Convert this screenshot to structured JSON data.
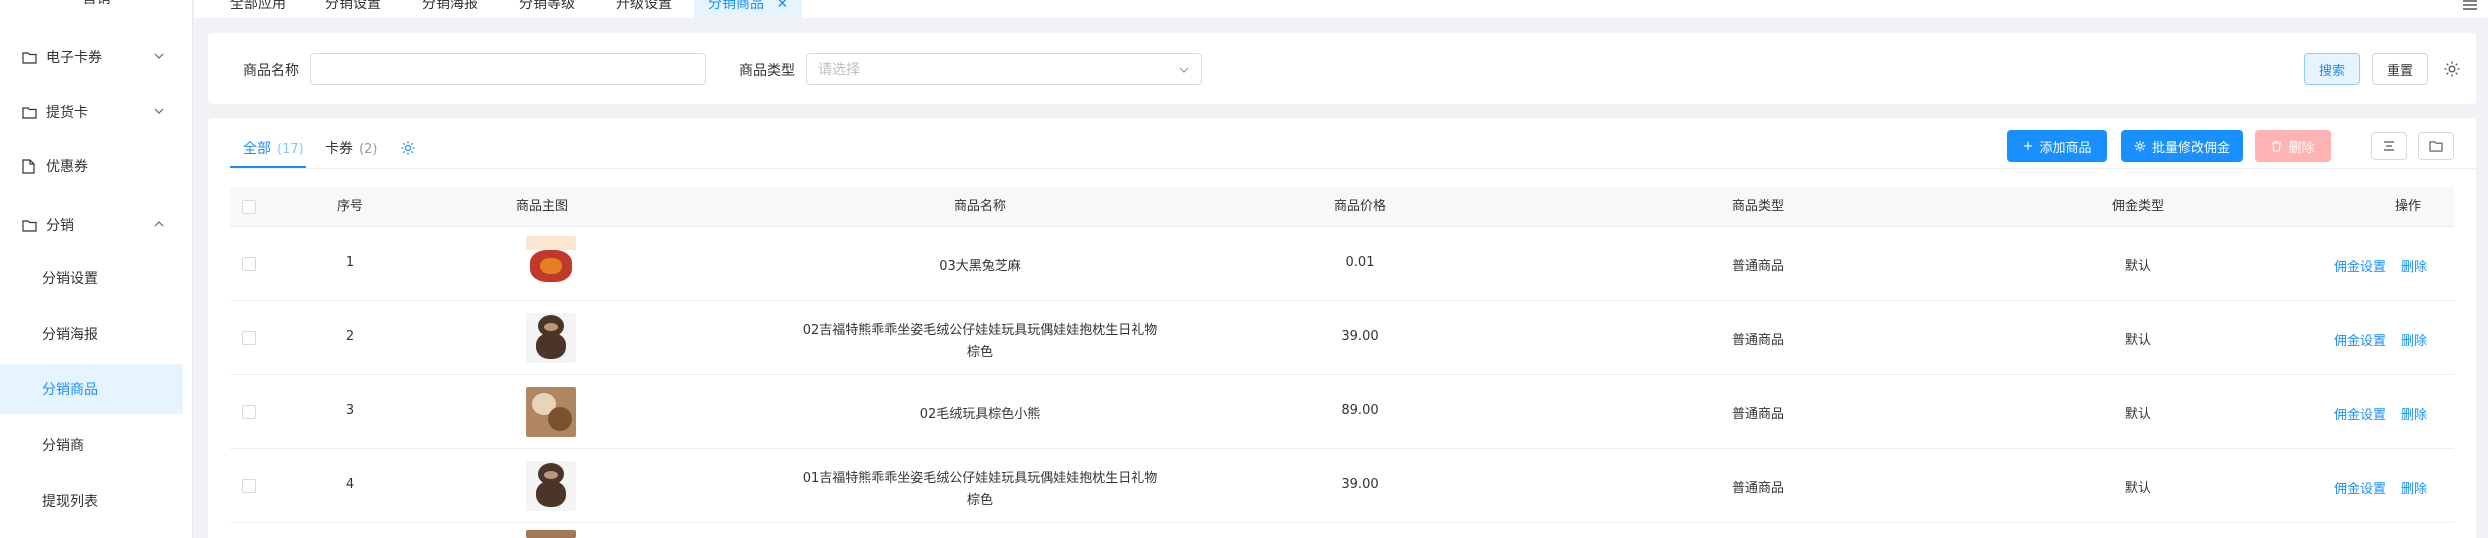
{
  "sidebar": {
    "top_label": "营销",
    "groups": [
      {
        "label": "电子卡券"
      },
      {
        "label": "提货卡"
      },
      {
        "label": "优惠券"
      },
      {
        "label": "分销"
      }
    ],
    "sub_items": [
      {
        "label": "分销设置"
      },
      {
        "label": "分销海报"
      },
      {
        "label": "分销商品"
      },
      {
        "label": "分销商"
      },
      {
        "label": "提现列表"
      }
    ]
  },
  "tabs": [
    {
      "label": "全部应用"
    },
    {
      "label": "分销设置"
    },
    {
      "label": "分销海报"
    },
    {
      "label": "分销等级"
    },
    {
      "label": "升级设置"
    },
    {
      "label": "分销商品"
    }
  ],
  "search": {
    "name_label": "商品名称",
    "name_value": "",
    "type_label": "商品类型",
    "type_placeholder": "请选择",
    "search_btn": "搜索",
    "reset_btn": "重置"
  },
  "view_tabs": [
    {
      "label": "全部",
      "count": "(17)"
    },
    {
      "label": "卡券",
      "count": "(2)"
    }
  ],
  "toolbar": {
    "add": "添加商品",
    "batch": "批量修改佣金",
    "delete": "删除"
  },
  "table": {
    "headers": [
      "序号",
      "商品主图",
      "商品名称",
      "商品价格",
      "商品类型",
      "佣金类型",
      "操作"
    ],
    "rows": [
      {
        "index": "1",
        "name1": "03大黑兔芝麻",
        "name2": "",
        "price": "0.01",
        "type": "普通商品",
        "commission": "默认",
        "action1": "佣金设置",
        "action2": "删除"
      },
      {
        "index": "2",
        "name1": "02吉福特熊乖乖坐姿毛绒公仔娃娃玩具玩偶娃娃抱枕生日礼物",
        "name2": "棕色",
        "price": "39.00",
        "type": "普通商品",
        "commission": "默认",
        "action1": "佣金设置",
        "action2": "删除"
      },
      {
        "index": "3",
        "name1": "02毛绒玩具棕色小熊",
        "name2": "",
        "price": "89.00",
        "type": "普通商品",
        "commission": "默认",
        "action1": "佣金设置",
        "action2": "删除"
      },
      {
        "index": "4",
        "name1": "01吉福特熊乖乖坐姿毛绒公仔娃娃玩具玩偶娃娃抱枕生日礼物",
        "name2": "棕色",
        "price": "39.00",
        "type": "普通商品",
        "commission": "默认",
        "action1": "佣金设置",
        "action2": "删除"
      }
    ]
  },
  "colors": {
    "accent": "#1890ff",
    "danger_disabled": "#ffb3b3",
    "active_bg": "#e6f4ff"
  }
}
